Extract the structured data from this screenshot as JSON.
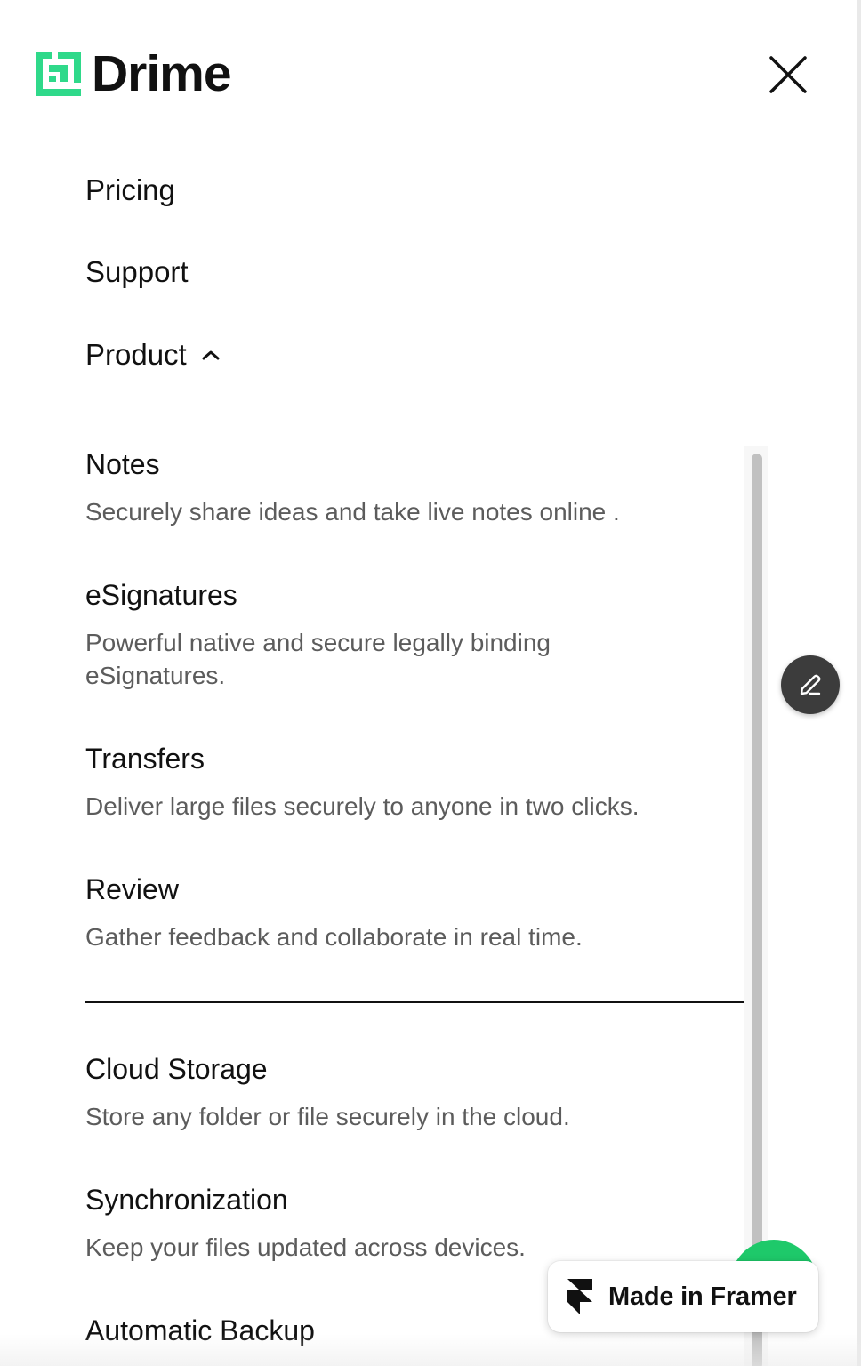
{
  "brand": {
    "name": "Drime",
    "accent_color": "#2fd98a"
  },
  "header": {
    "close_icon": "close-icon"
  },
  "nav": {
    "pricing": "Pricing",
    "support": "Support",
    "product": "Product",
    "product_expanded": true
  },
  "products": [
    {
      "title": "Notes",
      "description": "Securely share ideas and take live notes online ."
    },
    {
      "title": "eSignatures",
      "description": "Powerful native and secure legally binding eSignatures."
    },
    {
      "title": "Transfers",
      "description": "Deliver large files securely to anyone in two clicks."
    },
    {
      "title": "Review",
      "description": "Gather feedback and collaborate in real time."
    },
    {
      "title": "Cloud Storage",
      "description": "Store any folder or file securely in the cloud."
    },
    {
      "title": "Synchronization",
      "description": "Keep your files updated across devices."
    },
    {
      "title": "Automatic Backup",
      "description": ""
    }
  ],
  "floating": {
    "edit_icon": "pencil-icon",
    "chat_color": "#1ec96a"
  },
  "badge": {
    "label": "Made in Framer",
    "icon": "framer-icon"
  }
}
